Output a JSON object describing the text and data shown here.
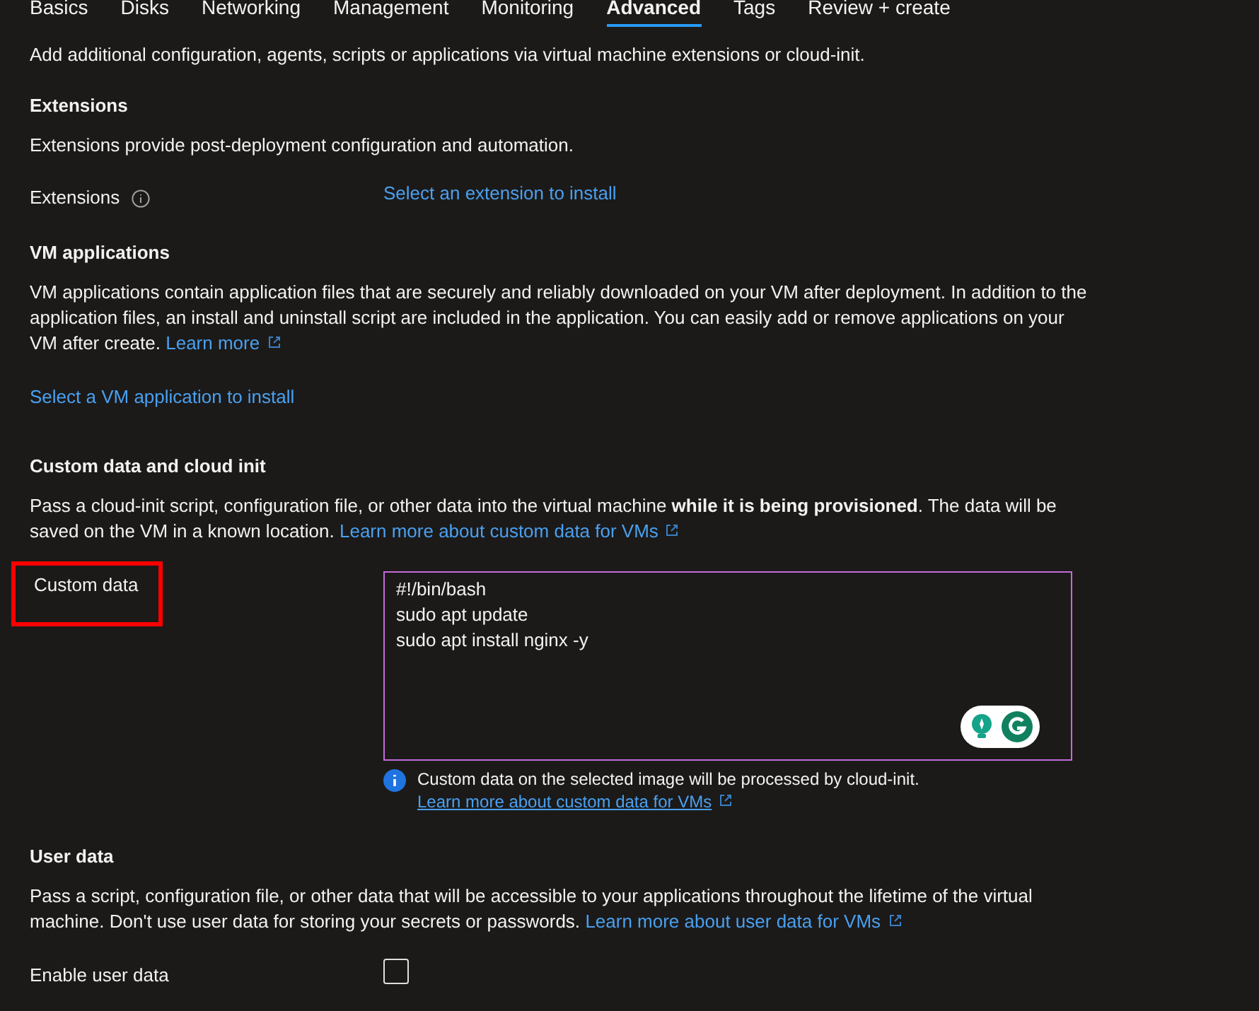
{
  "tabs": [
    {
      "label": "Basics",
      "selected": false
    },
    {
      "label": "Disks",
      "selected": false
    },
    {
      "label": "Networking",
      "selected": false
    },
    {
      "label": "Management",
      "selected": false
    },
    {
      "label": "Monitoring",
      "selected": false
    },
    {
      "label": "Advanced",
      "selected": true
    },
    {
      "label": "Tags",
      "selected": false
    },
    {
      "label": "Review + create",
      "selected": false
    }
  ],
  "intro": "Add additional configuration, agents, scripts or applications via virtual machine extensions or cloud-init.",
  "extensions": {
    "heading": "Extensions",
    "description": "Extensions provide post-deployment configuration and automation.",
    "label": "Extensions",
    "link": "Select an extension to install"
  },
  "vm_applications": {
    "heading": "VM applications",
    "description": "VM applications contain application files that are securely and reliably downloaded on your VM after deployment. In addition to the application files, an install and uninstall script are included in the application. You can easily add or remove applications on your VM after create.",
    "learn_more": "Learn more",
    "link": "Select a VM application to install"
  },
  "custom_data": {
    "heading": "Custom data and cloud init",
    "description": "Pass a cloud-init script, configuration file, or other data into the virtual machine **while it is being provisioned**. The data will be saved on the VM in a known location.",
    "learn_more": "Learn more about custom data for VMs",
    "label": "Custom data",
    "label_highlighted": true,
    "value": "#!/bin/bash\nsudo apt update\nsudo apt install nginx -y",
    "info": "Custom data on the selected image will be processed by cloud-init.",
    "info_link": "Learn more about custom data for VMs"
  },
  "user_data": {
    "heading": "User data",
    "description": "Pass a script, configuration file, or other data that will be accessible to your applications throughout the lifetime of the virtual machine. Don't use user data for storing your secrets or passwords.",
    "learn_more": "Learn more about user data for VMs",
    "label": "Enable user data",
    "checked": false
  }
}
